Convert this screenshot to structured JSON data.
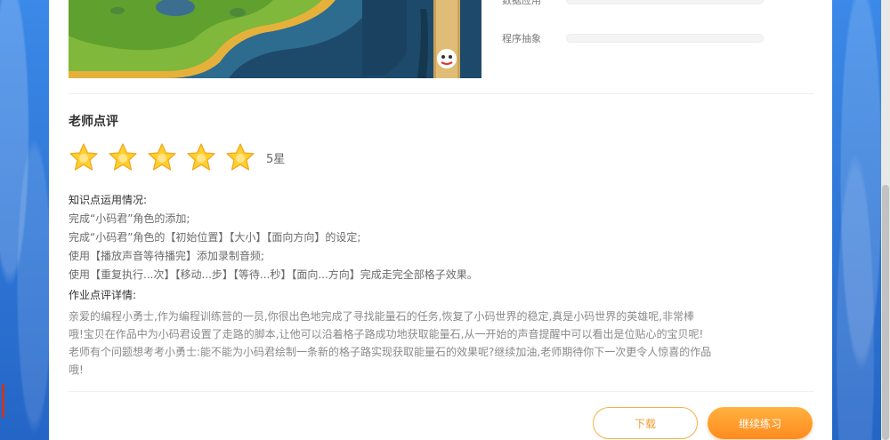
{
  "stats": [
    {
      "label": "数据应用"
    },
    {
      "label": "程序抽象"
    }
  ],
  "review": {
    "title": "老师点评",
    "rating": 5,
    "rating_label": "5星",
    "knowledge_title": "知识点运用情况:",
    "knowledge_lines": [
      "完成“小码君”角色的添加;",
      "完成“小码君”角色的【初始位置】【大小】【面向方向】的设定;",
      "使用【播放声音等待播完】添加录制音频;",
      "使用【重复执行...次】【移动...步】【等待...秒】【面向...方向】完成走完全部格子效果。"
    ],
    "detail_title": "作业点评详情:",
    "detail_lines": [
      "亲爱的编程小勇士,作为编程训练营的一员,你很出色地完成了寻找能量石的任务,恢复了小码世界的稳定,真是小码世界的英雄呢,非常棒",
      "哦!宝贝在作品中为小码君设置了走路的脚本,让他可以沿着格子路成功地获取能量石,从一开始的声音提醒中可以看出是位贴心的宝贝呢!",
      "老师有个问题想考考小勇士:能不能为小码君绘制一条新的格子路实现获取能量石的效果呢?继续加油,老师期待你下一次更令人惊喜的作品",
      "哦!"
    ]
  },
  "buttons": {
    "download": "下载",
    "continue": "继续练习"
  },
  "colors": {
    "accent": "#ff8a1f",
    "star": "#ffcf2e",
    "background": "#2a73d6"
  }
}
